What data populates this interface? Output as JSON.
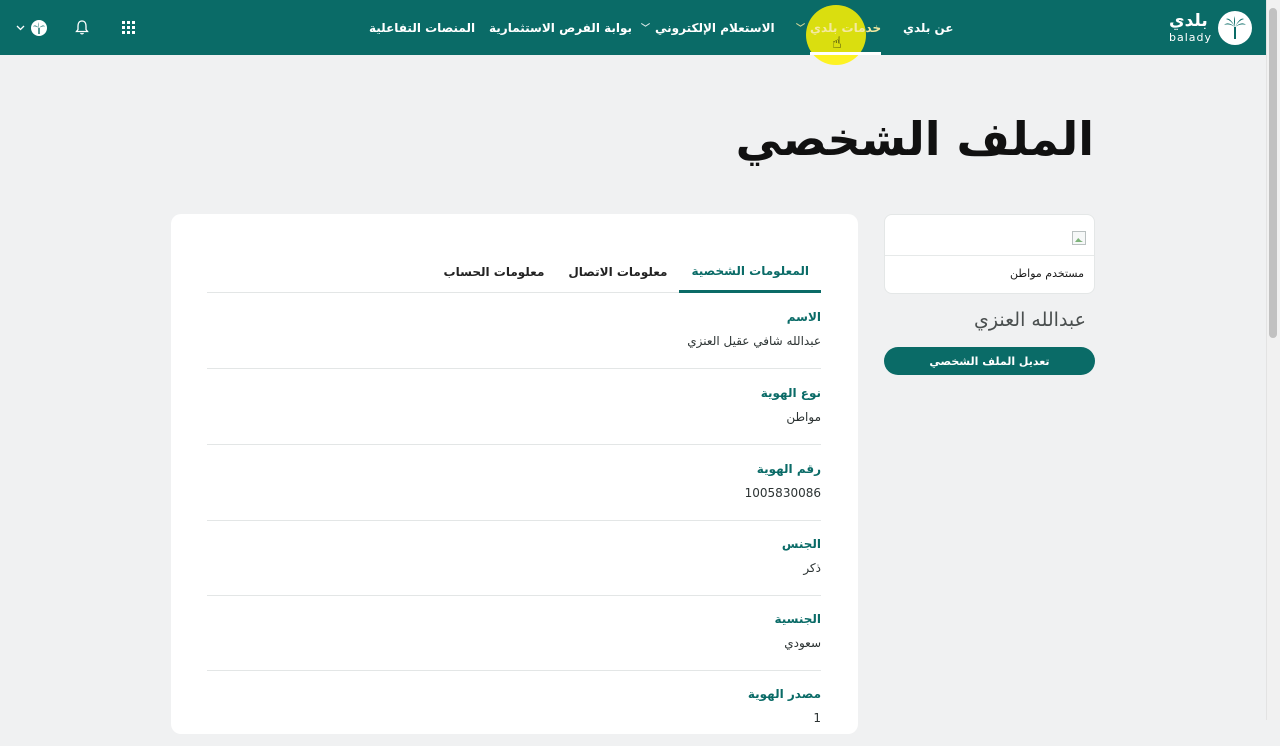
{
  "brand": {
    "name_ar": "بلدي",
    "name_en": "balady"
  },
  "nav": {
    "items": [
      {
        "label": "عن بلدي",
        "has_dropdown": false
      },
      {
        "label": "خدمات بلدي",
        "has_dropdown": true,
        "active": true
      },
      {
        "label": "الاستعلام الإلكتروني",
        "has_dropdown": true
      },
      {
        "label": "بوابة الفرص الاستثمارية",
        "has_dropdown": false
      },
      {
        "label": "المنصات التفاعلية",
        "has_dropdown": false
      }
    ],
    "tools": [
      "apps-grid-icon",
      "bell-icon",
      "user-globe-icon",
      "chevron-down-icon"
    ]
  },
  "page": {
    "title": "الملف الشخصي"
  },
  "profile": {
    "user_type": "مستخدم مواطن",
    "name": "عبدالله العنزي",
    "edit_button": "تعديل الملف الشخصي"
  },
  "tabs": [
    {
      "label": "المعلومات الشخصية",
      "active": true
    },
    {
      "label": "معلومات الاتصال",
      "active": false
    },
    {
      "label": "معلومات الحساب",
      "active": false
    }
  ],
  "fields": [
    {
      "label": "الاسم",
      "value": "عبدالله شافي عقيل العنزي"
    },
    {
      "label": "نوع الهوية",
      "value": "مواطن"
    },
    {
      "label": "رقم الهوية",
      "value": "1005830086"
    },
    {
      "label": "الجنس",
      "value": "ذكر"
    },
    {
      "label": "الجنسية",
      "value": "سعودي"
    },
    {
      "label": "مصدر الهوية",
      "value": "1"
    }
  ],
  "colors": {
    "primary": "#0a6b67",
    "active_nav_text": "#f4e9a0",
    "page_background": "#f0f1f2"
  }
}
